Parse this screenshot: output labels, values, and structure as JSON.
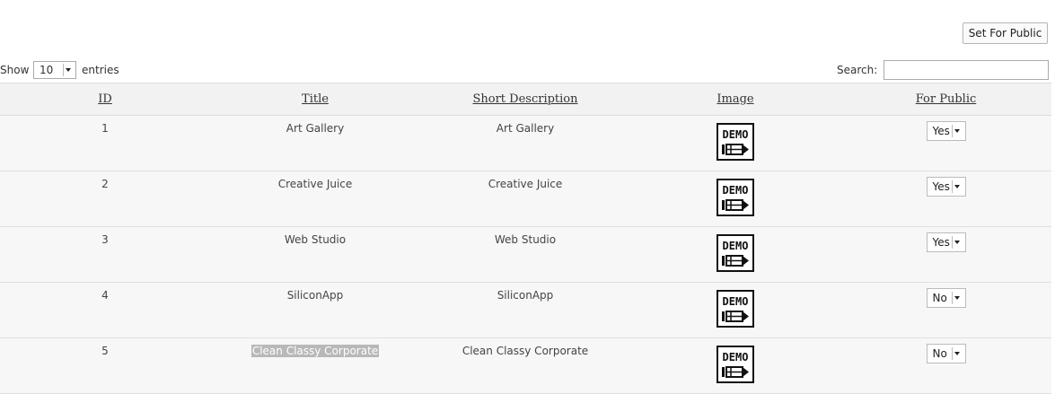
{
  "toolbar": {
    "set_public_label": "Set For Public"
  },
  "controls": {
    "show_label": "Show",
    "entries_label": "entries",
    "page_length": "10",
    "search_label": "Search:",
    "search_value": ""
  },
  "table": {
    "columns": [
      "ID",
      "Title",
      "Short Description",
      "Image",
      "For Public"
    ],
    "rows": [
      {
        "id": "1",
        "title": "Art Gallery",
        "desc": "Art Gallery",
        "image": "demo-image-icon",
        "public": "Yes"
      },
      {
        "id": "2",
        "title": "Creative Juice",
        "desc": "Creative Juice",
        "image": "demo-image-icon",
        "public": "Yes"
      },
      {
        "id": "3",
        "title": "Web Studio",
        "desc": "Web Studio",
        "image": "demo-image-icon",
        "public": "Yes"
      },
      {
        "id": "4",
        "title": "SiliconApp",
        "desc": "SiliconApp",
        "image": "demo-image-icon",
        "public": "No"
      },
      {
        "id": "5",
        "title": "Clean Classy Corporate",
        "desc": "Clean Classy Corporate",
        "image": "demo-image-icon",
        "public": "No"
      }
    ]
  },
  "image_label": "DEMO"
}
